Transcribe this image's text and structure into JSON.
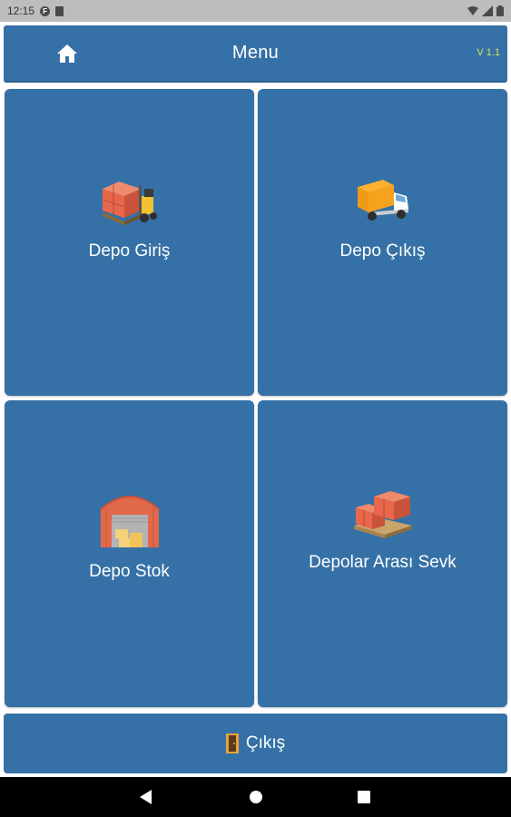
{
  "status_bar": {
    "time": "12:15",
    "f_badge": "F"
  },
  "header": {
    "title": "Menu",
    "version": "V 1.1"
  },
  "tiles": [
    {
      "label": "Depo Giriş",
      "icon": "forklift-icon"
    },
    {
      "label": "Depo Çıkış",
      "icon": "truck-icon"
    },
    {
      "label": "Depo Stok",
      "icon": "warehouse-icon"
    },
    {
      "label": "Depolar Arası Sevk",
      "icon": "pallet-boxes-icon"
    }
  ],
  "exit": {
    "label": "Çıkış",
    "icon": "door-exit-icon"
  },
  "colors": {
    "primary": "#3571a6",
    "background": "#ffffff",
    "status_bar": "#bdbdbd",
    "version_text": "#cfe85c"
  }
}
